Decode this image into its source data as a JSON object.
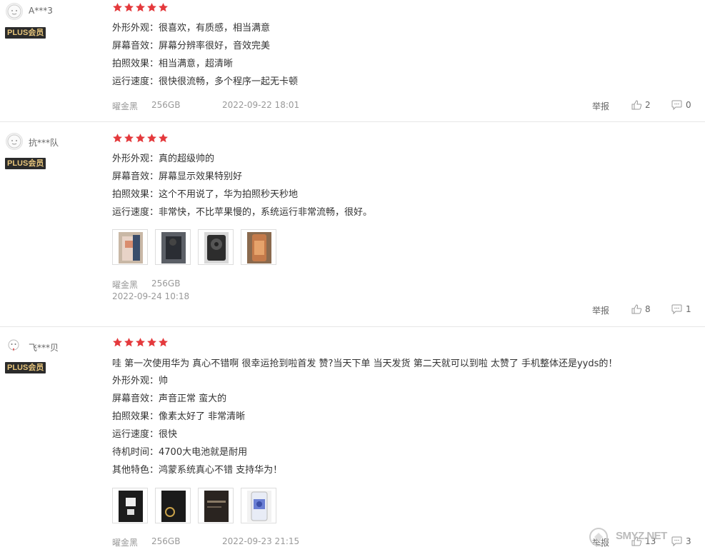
{
  "reviews": [
    {
      "username": "A***3",
      "badge": "PLUS会员",
      "rating": 5,
      "lines": [
        {
          "label": "外形外观：",
          "text": "很喜欢，有质感，相当满意"
        },
        {
          "label": "屏幕音效：",
          "text": "屏幕分辨率很好，音效完美"
        },
        {
          "label": "拍照效果：",
          "text": "相当满意，超清晰"
        },
        {
          "label": "运行速度：",
          "text": "很快很流畅，多个程序一起无卡顿"
        }
      ],
      "color": "曜金黑",
      "storage": "256GB",
      "date": "2022-09-22 18:01",
      "report_label": "举报",
      "likes": "2",
      "comments": "0"
    },
    {
      "username": "抗***队",
      "badge": "PLUS会员",
      "rating": 5,
      "lines": [
        {
          "label": "外形外观：",
          "text": "真的超级帅的"
        },
        {
          "label": "屏幕音效：",
          "text": "屏幕显示效果特别好"
        },
        {
          "label": "拍照效果：",
          "text": "这个不用说了，华为拍照秒天秒地"
        },
        {
          "label": "运行速度：",
          "text": "非常快，不比苹果慢的，系统运行非常流畅，很好。"
        }
      ],
      "images": [
        "review-photo-1",
        "review-photo-2",
        "review-photo-3",
        "review-photo-4"
      ],
      "color": "曜金黑",
      "storage": "256GB",
      "date": "2022-09-24 10:18",
      "report_label": "举报",
      "likes": "8",
      "comments": "1"
    },
    {
      "username": "飞***贝",
      "badge": "PLUS会员",
      "rating": 5,
      "intro": "哇 第一次使用华为 真心不错啊 很幸运抢到啦首发 赞?当天下单 当天发货 第二天就可以到啦 太赞了 手机整体还是yyds的！",
      "lines": [
        {
          "label": "外形外观：",
          "text": "帅"
        },
        {
          "label": "屏幕音效：",
          "text": "声音正常 蛮大的"
        },
        {
          "label": "拍照效果：",
          "text": "像素太好了 非常清晰"
        },
        {
          "label": "运行速度：",
          "text": "很快"
        },
        {
          "label": "待机时间：",
          "text": "4700大电池就是耐用"
        },
        {
          "label": "其他特色：",
          "text": "鸿蒙系统真心不错 支持华为！"
        }
      ],
      "images": [
        "review-photo-1",
        "review-photo-2",
        "review-photo-3",
        "review-photo-4"
      ],
      "color": "曜金黑",
      "storage": "256GB",
      "date": "2022-09-23 21:15",
      "report_label": "举报",
      "likes": "13",
      "comments": "3"
    }
  ],
  "watermark": "SMYZ.NET",
  "colors": {
    "star": "#e4393c",
    "badge_bg": "#2b2b2b",
    "badge_text": "#e7c57b"
  }
}
